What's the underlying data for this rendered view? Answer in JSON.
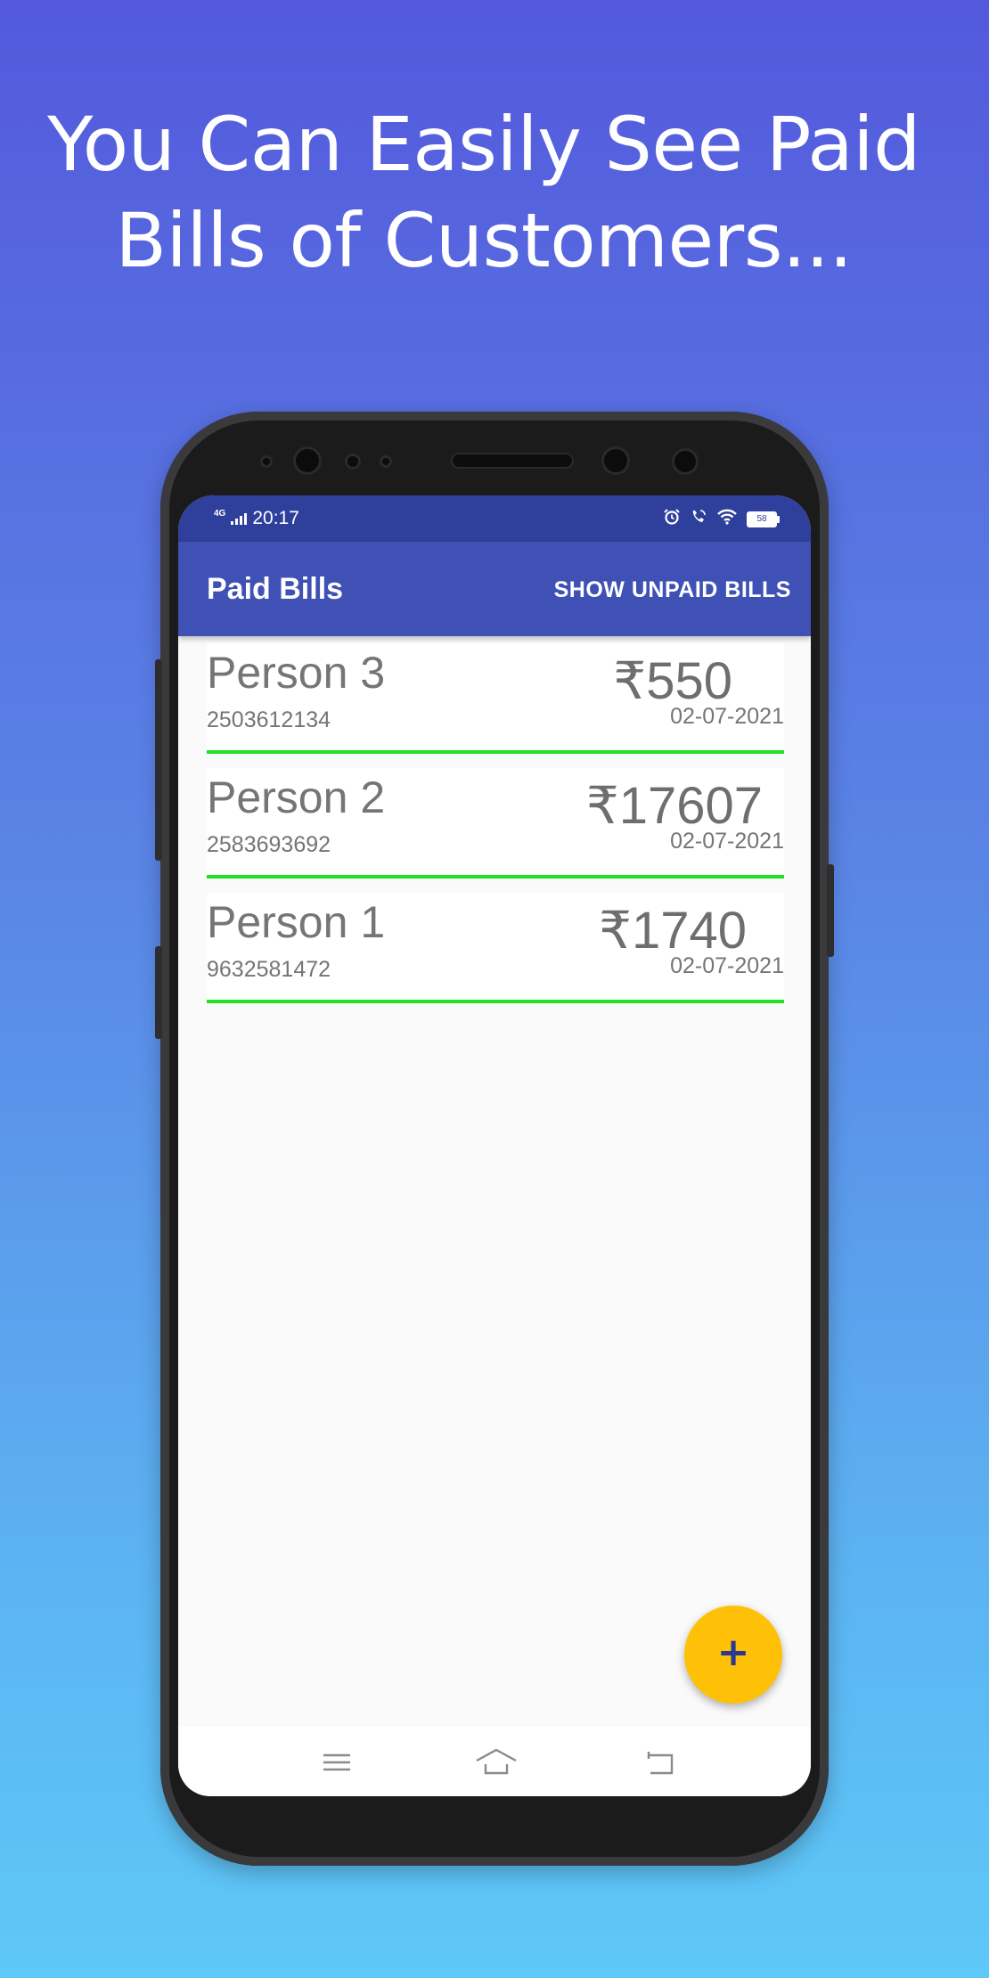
{
  "headline": {
    "line1": "You Can Easily See Paid",
    "line2": "Bills of Customers..."
  },
  "status_bar": {
    "network": "4G",
    "time": "20:17",
    "battery": "58"
  },
  "app_bar": {
    "title": "Paid Bills",
    "action_label": "SHOW UNPAID BILLS"
  },
  "bills": [
    {
      "name": "Person 3",
      "phone": "2503612134",
      "amount": "₹550",
      "date": "02-07-2021"
    },
    {
      "name": "Person 2",
      "phone": "2583693692",
      "amount": "₹17607",
      "date": "02-07-2021"
    },
    {
      "name": "Person 1",
      "phone": "9632581472",
      "amount": "₹1740",
      "date": "02-07-2021"
    }
  ],
  "fab": {
    "label": "+"
  },
  "colors": {
    "primary": "#3f51b5",
    "primary_dark": "#2f3f9c",
    "accent": "#ffc107",
    "divider": "#22e022"
  }
}
